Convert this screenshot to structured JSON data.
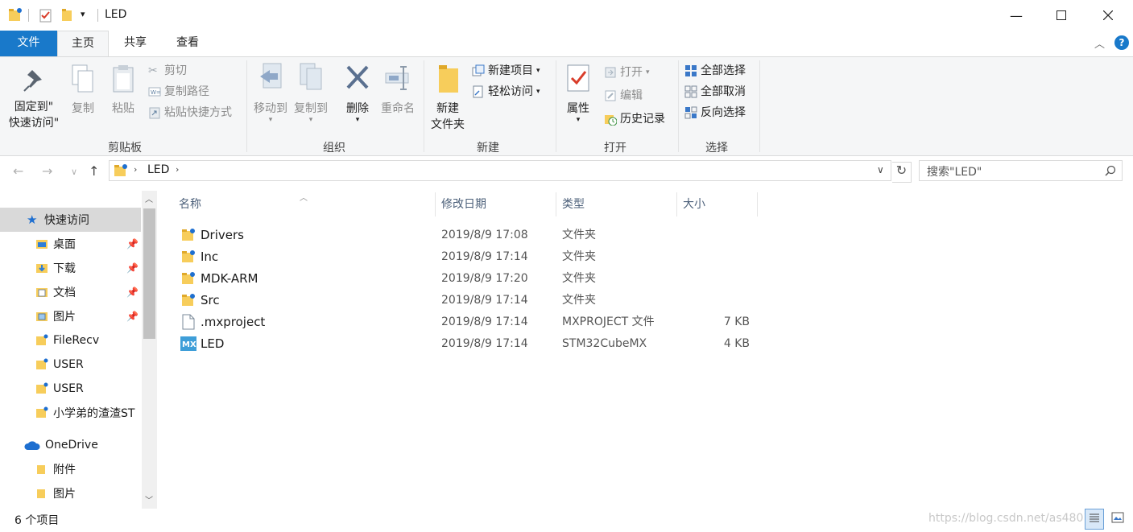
{
  "window": {
    "title": "LED",
    "controls": [
      "minimize",
      "maximize",
      "close"
    ]
  },
  "ribbon_tabs": [
    {
      "label": "文件"
    },
    {
      "label": "主页"
    },
    {
      "label": "共享"
    },
    {
      "label": "查看"
    }
  ],
  "ribbon": {
    "clipboard": {
      "pin_line1": "固定到\"",
      "pin_line2": "快速访问\"",
      "copy": "复制",
      "paste": "粘贴",
      "cut": "剪切",
      "copy_path": "复制路径",
      "paste_shortcut": "粘贴快捷方式",
      "group_label": "剪贴板"
    },
    "organize": {
      "move_to": "移动到",
      "copy_to": "复制到",
      "delete": "删除",
      "rename": "重命名",
      "group_label": "组织"
    },
    "new": {
      "new_folder_line1": "新建",
      "new_folder_line2": "文件夹",
      "new_item": "新建项目",
      "easy_access": "轻松访问",
      "group_label": "新建"
    },
    "open": {
      "properties": "属性",
      "open": "打开",
      "edit": "编辑",
      "history": "历史记录",
      "group_label": "打开"
    },
    "select": {
      "select_all": "全部选择",
      "select_none": "全部取消",
      "invert": "反向选择",
      "group_label": "选择"
    }
  },
  "address": {
    "crumb": "LED",
    "search_placeholder": "搜索\"LED\""
  },
  "nav_pane": {
    "quick_access": "快速访问",
    "items": [
      {
        "label": "桌面",
        "pinned": true
      },
      {
        "label": "下载",
        "pinned": true
      },
      {
        "label": "文档",
        "pinned": true
      },
      {
        "label": "图片",
        "pinned": true
      },
      {
        "label": "FileRecv",
        "pinned": false
      },
      {
        "label": "USER",
        "pinned": false
      },
      {
        "label": "USER",
        "pinned": false
      },
      {
        "label": "小学弟的渣渣ST",
        "pinned": false
      }
    ],
    "onedrive": "OneDrive",
    "onedrive_items": [
      {
        "label": "附件"
      },
      {
        "label": "图片"
      }
    ]
  },
  "columns": {
    "name": "名称",
    "date": "修改日期",
    "type": "类型",
    "size": "大小"
  },
  "files": [
    {
      "name": "Drivers",
      "date": "2019/8/9 17:08",
      "type": "文件夹",
      "size": "",
      "icon": "folder-icon"
    },
    {
      "name": "Inc",
      "date": "2019/8/9 17:14",
      "type": "文件夹",
      "size": "",
      "icon": "folder-icon"
    },
    {
      "name": "MDK-ARM",
      "date": "2019/8/9 17:20",
      "type": "文件夹",
      "size": "",
      "icon": "folder-icon"
    },
    {
      "name": "Src",
      "date": "2019/8/9 17:14",
      "type": "文件夹",
      "size": "",
      "icon": "folder-icon"
    },
    {
      "name": ".mxproject",
      "date": "2019/8/9 17:14",
      "type": "MXPROJECT 文件",
      "size": "7 KB",
      "icon": "file-icon"
    },
    {
      "name": "LED",
      "date": "2019/8/9 17:14",
      "type": "STM32CubeMX",
      "size": "4 KB",
      "icon": "cubemx-icon"
    }
  ],
  "status": {
    "count": "6 个项目",
    "watermark": "https://blog.csdn.net/as480133"
  },
  "colors": {
    "file_tab": "#1979ca",
    "ribbon_bg": "#f5f6f7",
    "folder": "#f7cd5b",
    "selected": "#d9d9d9"
  }
}
